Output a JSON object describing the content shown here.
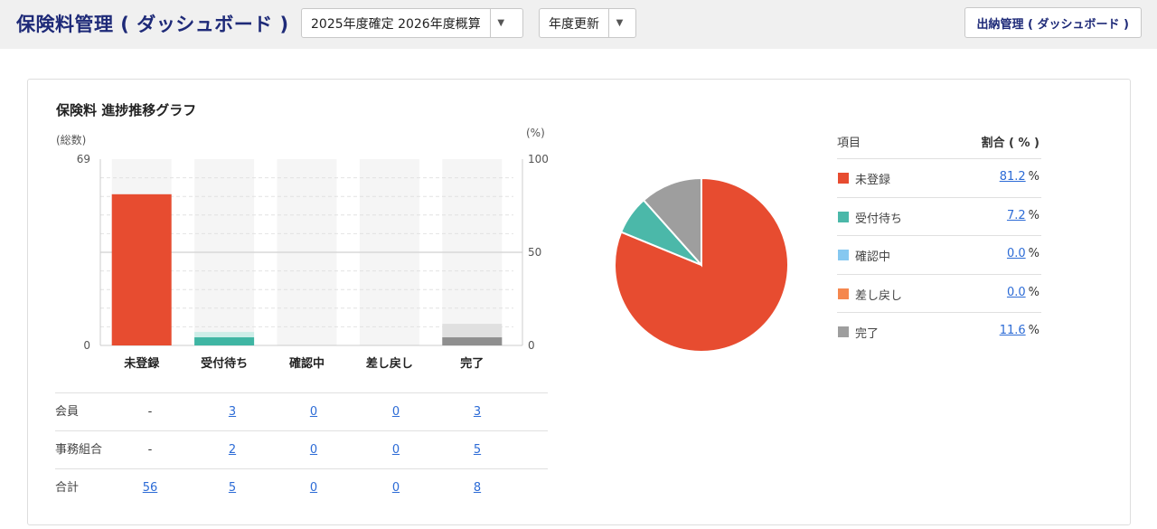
{
  "header": {
    "title": "保険料管理 ( ダッシュボード )",
    "fiscal_select": "2025年度確定 2026年度概算",
    "update_select": "年度更新",
    "payment_button": "出納管理 ( ダッシュボード )"
  },
  "card": {
    "title": "保険料 進捗推移グラフ"
  },
  "chart_data": {
    "type": "bar",
    "categories": [
      "未登録",
      "受付待ち",
      "確認中",
      "差し戻し",
      "完了"
    ],
    "series": [
      {
        "name": "会員",
        "values": [
          0,
          3,
          0,
          0,
          3
        ]
      },
      {
        "name": "事務組合",
        "values": [
          0,
          2,
          0,
          0,
          5
        ]
      },
      {
        "name": "合計",
        "values": [
          56,
          5,
          0,
          0,
          8
        ]
      }
    ],
    "colors": [
      "#e74c30",
      "#4bb8a9",
      "#86c8f0",
      "#f5874e",
      "#9e9e9e"
    ],
    "ylabel": "(総数)",
    "ylim": [
      0,
      69
    ],
    "y2label": "(%)",
    "y2lim": [
      0,
      100
    ],
    "y_ticks": [
      "69",
      "0"
    ],
    "y2_ticks": [
      "100",
      "50",
      "0"
    ],
    "percent_values": [
      81.2,
      7.2,
      0.0,
      0.0,
      11.6
    ]
  },
  "table": {
    "rows": [
      {
        "label": "会員",
        "cells": [
          "-",
          "3",
          "0",
          "0",
          "3"
        ]
      },
      {
        "label": "事務組合",
        "cells": [
          "-",
          "2",
          "0",
          "0",
          "5"
        ]
      },
      {
        "label": "合計",
        "cells": [
          "56",
          "5",
          "0",
          "0",
          "8"
        ]
      }
    ]
  },
  "legend": {
    "header_item": "項目",
    "header_ratio": "割合 ( % )",
    "unit": "%",
    "rows": [
      {
        "name": "未登録",
        "value": "81.2",
        "color": "#e74c30"
      },
      {
        "name": "受付待ち",
        "value": "7.2",
        "color": "#4bb8a9"
      },
      {
        "name": "確認中",
        "value": "0.0",
        "color": "#86c8f0"
      },
      {
        "name": "差し戻し",
        "value": "0.0",
        "color": "#f5874e"
      },
      {
        "name": "完了",
        "value": "11.6",
        "color": "#9e9e9e"
      }
    ]
  }
}
